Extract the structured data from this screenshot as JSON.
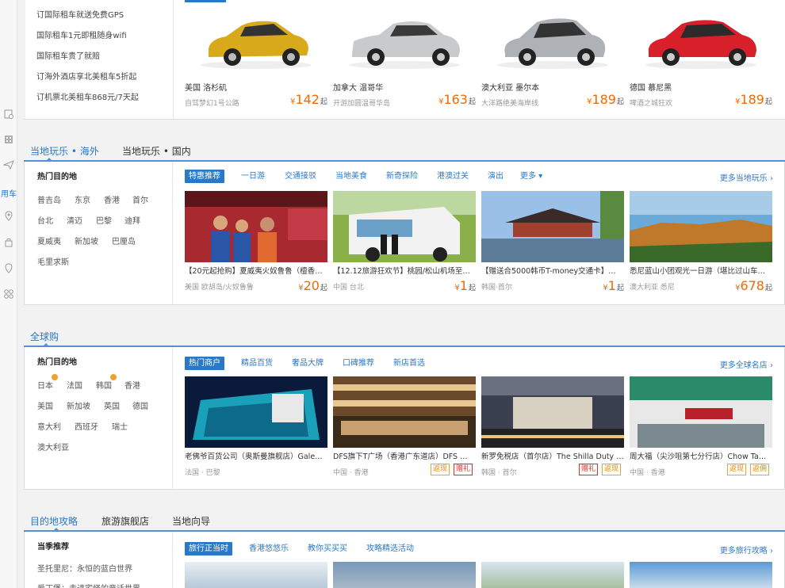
{
  "rail": {
    "label": "用车"
  },
  "car_rental": {
    "links": [
      "订国际租车就送免费GPS",
      "国际租车1元即租随身wifi",
      "国际租车贵了就赔",
      "订海外酒店享北美租车5折起",
      "订机票北美租车868元/7天起"
    ],
    "currency": "¥",
    "from": "起",
    "cards": [
      {
        "city": "美国 洛杉矶",
        "sub": "自驾梦幻1号公路",
        "price": "142",
        "color": "#d9a91c"
      },
      {
        "city": "加拿大 温哥华",
        "sub": "开游加圆温哥华岛",
        "price": "163",
        "color": "#c8cacc"
      },
      {
        "city": "澳大利亚 墨尔本",
        "sub": "大洋路绝美海岸线",
        "price": "189",
        "color": "#aeb2b6"
      },
      {
        "city": "德国 慕尼黑",
        "sub": "啤酒之城狂欢",
        "price": "189",
        "color": "#d8202a"
      }
    ]
  },
  "local_play": {
    "tabs": [
      "当地玩乐 • 海外",
      "当地玩乐 • 国内"
    ],
    "hot_title": "热门目的地",
    "destinations": [
      [
        "普吉岛",
        "东京",
        "香港",
        "首尔"
      ],
      [
        "台北",
        "清迈",
        "巴黎",
        "迪拜"
      ],
      [
        "夏威夷",
        "新加坡",
        "巴厘岛"
      ],
      [
        "毛里求斯"
      ]
    ],
    "subtabs": [
      "特惠推荐",
      "一日游",
      "交通接驳",
      "当地美食",
      "新奇探险",
      "港澳过关",
      "演出",
      "更多 ▾"
    ],
    "more": "更多当地玩乐 ›",
    "tiles": [
      {
        "title": "【20元起抢购】夏威夷火奴鲁鲁（檀香…",
        "loc": "美国 欧胡岛/火奴鲁鲁",
        "price": "20"
      },
      {
        "title": "【12.12旅游狂欢节】桃园/松山机场至…",
        "loc": "中国 台北",
        "price": "1"
      },
      {
        "title": "【赠送合5000韩币T-money交通卡】…",
        "loc": "韩国·首尔",
        "price": "1"
      },
      {
        "title": "悉尼蓝山小团观光一日游（堪比过山车…",
        "loc": "澳大利亚 悉尼",
        "price": "678"
      }
    ]
  },
  "global_shop": {
    "tabs": [
      "全球购"
    ],
    "hot_title": "热门目的地",
    "destinations": [
      [
        "日本",
        "法国",
        "韩国",
        "香港"
      ],
      [
        "美国",
        "新加坡",
        "英国",
        "德国"
      ],
      [
        "意大利",
        "西班牙",
        "瑞士"
      ],
      [
        "澳大利亚"
      ]
    ],
    "subtabs": [
      "热门商户",
      "精品百货",
      "奢品大牌",
      "口碑推荐",
      "新店首选"
    ],
    "more": "更多全球名店 ›",
    "tiles": [
      {
        "title": "老佛爷百货公司（奥斯曼旗舰店）Gale…",
        "loc": "法国 · 巴黎",
        "tags": []
      },
      {
        "title": "DFS旗下T广场（香港广东道店）DFS …",
        "loc": "中国 · 香港",
        "tags": [
          "返现",
          "赠礼"
        ]
      },
      {
        "title": "新罗免税店（首尔店）The Shilla Duty …",
        "loc": "韩国 · 首尔",
        "tags": [
          "赠礼",
          "返现"
        ]
      },
      {
        "title": "周大福（尖沙咀第七分行店）Chow Ta…",
        "loc": "中国 · 香港",
        "tags": [
          "返现",
          "返佣"
        ]
      }
    ]
  },
  "guide": {
    "tabs": [
      "目的地攻略",
      "旅游旗舰店",
      "当地向导"
    ],
    "season_title": "当季推荐",
    "season_items": [
      "圣托里尼：永恒的蓝白世界",
      "爱丁堡：走进宅怪的童话世界"
    ],
    "subtabs": [
      "旅行正当时",
      "香港悠悠乐",
      "教你买买买",
      "攻略精选活动"
    ],
    "more": "更多旅行攻略 ›"
  }
}
